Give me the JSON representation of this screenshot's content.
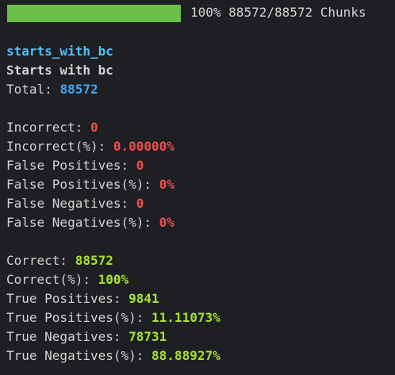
{
  "colors": {
    "background": "#1e1f22",
    "text": "#d4d4d4",
    "header": "#4fc1ff",
    "red": "#f14c4c",
    "green": "#a6e22e",
    "blue": "#3fa9f5",
    "bar": "#6abf4b"
  },
  "progress": {
    "fraction": 1.0,
    "percent_label": "100%",
    "count_label": "88572/88572",
    "unit_label": "Chunks"
  },
  "test": {
    "name": "starts_with_bc",
    "description": "Starts with bc",
    "total_label": "Total: ",
    "total_value": "88572"
  },
  "errors": [
    {
      "label": "Incorrect: ",
      "value": "0"
    },
    {
      "label": "Incorrect(%): ",
      "value": "0.00000%"
    },
    {
      "label": "False Positives: ",
      "value": "0"
    },
    {
      "label": "False Positives(%): ",
      "value": "0%"
    },
    {
      "label": "False Negatives: ",
      "value": "0"
    },
    {
      "label": "False Negatives(%): ",
      "value": "0%"
    }
  ],
  "results": [
    {
      "label": "Correct: ",
      "value": "88572"
    },
    {
      "label": "Correct(%): ",
      "value": "100%"
    },
    {
      "label": "True Positives: ",
      "value": "9841"
    },
    {
      "label": "True Positives(%): ",
      "value": "11.11073%"
    },
    {
      "label": "True Negatives: ",
      "value": "78731"
    },
    {
      "label": "True Negatives(%): ",
      "value": "88.88927%"
    }
  ]
}
